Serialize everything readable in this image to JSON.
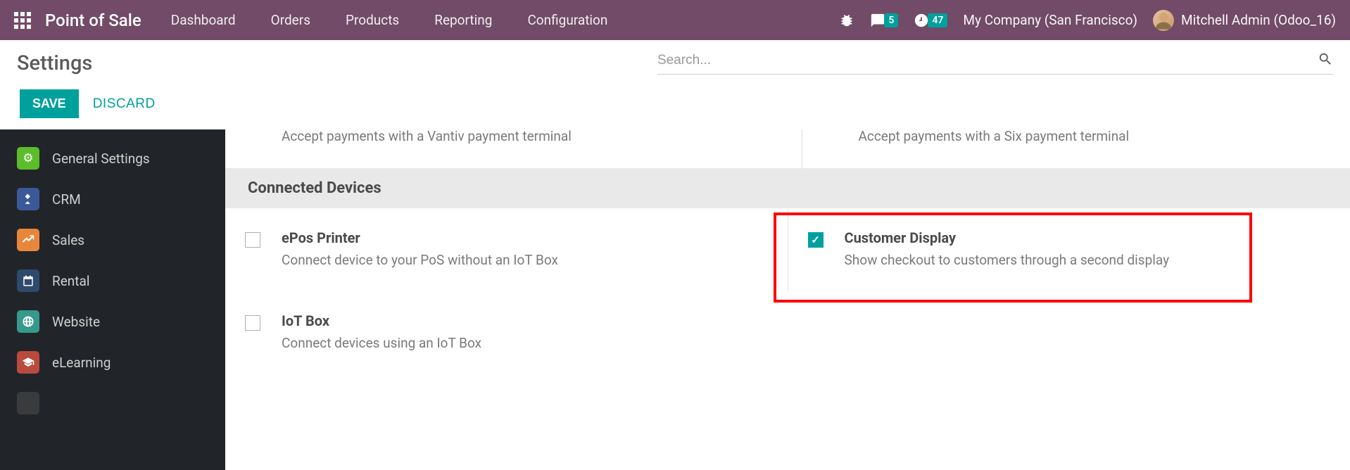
{
  "navbar": {
    "brand": "Point of Sale",
    "links": [
      "Dashboard",
      "Orders",
      "Products",
      "Reporting",
      "Configuration"
    ],
    "messages_badge": "5",
    "activities_badge": "47",
    "company": "My Company (San Francisco)",
    "user_name": "Mitchell Admin (Odoo_16)"
  },
  "header": {
    "title": "Settings",
    "search_placeholder": "Search..."
  },
  "actions": {
    "save": "SAVE",
    "discard": "DISCARD"
  },
  "sidebar": {
    "items": [
      {
        "label": "General Settings",
        "icon": "⚙",
        "bg": "bg-green"
      },
      {
        "label": "CRM",
        "icon": "🤝",
        "bg": "bg-blue"
      },
      {
        "label": "Sales",
        "icon": "📈",
        "bg": "bg-orange"
      },
      {
        "label": "Rental",
        "icon": "📅",
        "bg": "bg-darkblue"
      },
      {
        "label": "Website",
        "icon": "🌐",
        "bg": "bg-teal"
      },
      {
        "label": "eLearning",
        "icon": "🎓",
        "bg": "bg-red"
      }
    ]
  },
  "partial_settings": {
    "left": {
      "desc": "Accept payments with a Vantiv payment terminal"
    },
    "right": {
      "desc": "Accept payments with a Six payment terminal"
    }
  },
  "section": {
    "title": "Connected Devices"
  },
  "settings": {
    "row1": {
      "left": {
        "title": "ePos Printer",
        "desc": "Connect device to your PoS without an IoT Box",
        "checked": false
      },
      "right": {
        "title": "Customer Display",
        "desc": "Show checkout to customers through a second display",
        "checked": true
      }
    },
    "row2": {
      "left": {
        "title": "IoT Box",
        "desc": "Connect devices using an IoT Box",
        "checked": false
      }
    }
  }
}
